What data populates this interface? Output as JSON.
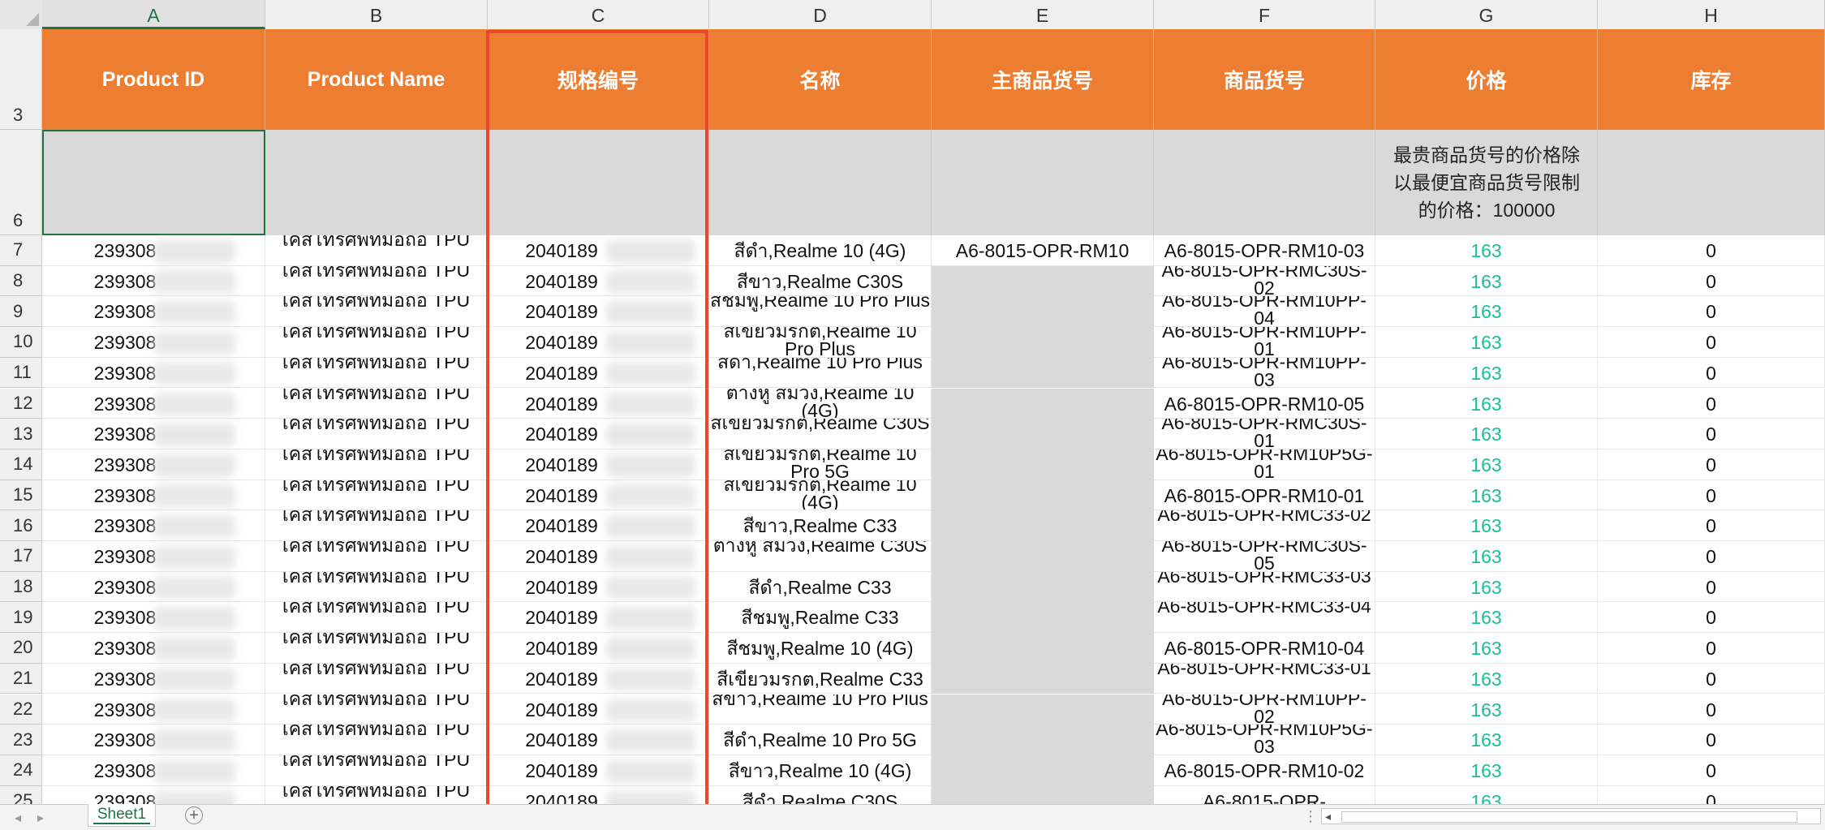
{
  "columns": [
    "A",
    "B",
    "C",
    "D",
    "E",
    "F",
    "G",
    "H"
  ],
  "header": {
    "row_number": "3",
    "labels": [
      "Product ID",
      "Product Name",
      "规格编号",
      "名称",
      "主商品货号",
      "商品货号",
      "价格",
      "库存"
    ]
  },
  "row6": {
    "row_number": "6",
    "note": "最贵商品货号的价格除以最便宜商品货号限制的价格：100000"
  },
  "rows": [
    {
      "n": "7",
      "id": "239308",
      "name": "เคสโทรศัพท์มือถือ TPU",
      "spec": "2040189",
      "title": "สีดำ,Realme 10 (4G)",
      "main_sku": "A6-8015-OPR-RM10",
      "sku": "A6-8015-OPR-RM10-03",
      "price": "163",
      "stock": "0"
    },
    {
      "n": "8",
      "id": "239308",
      "name": "เคสโทรศัพท์มือถือ TPU",
      "spec": "2040189",
      "title": "สีขาว,Realme C30S",
      "main_sku": "",
      "sku": "A6-8015-OPR-RMC30S-02",
      "price": "163",
      "stock": "0"
    },
    {
      "n": "9",
      "id": "239308",
      "name": "เคสโทรศัพท์มือถือ TPU",
      "spec": "2040189",
      "title": "สีชมพู,Realme 10 Pro Plus",
      "main_sku": "",
      "sku": "A6-8015-OPR-RM10PP-04",
      "price": "163",
      "stock": "0"
    },
    {
      "n": "10",
      "id": "239308",
      "name": "เคสโทรศัพท์มือถือ TPU",
      "spec": "2040189",
      "title": "สีเขียวมรกต,Realme 10 Pro Plus",
      "main_sku": "",
      "sku": "A6-8015-OPR-RM10PP-01",
      "price": "163",
      "stock": "0"
    },
    {
      "n": "11",
      "id": "239308",
      "name": "เคสโทรศัพท์มือถือ TPU",
      "spec": "2040189",
      "title": "สีดำ,Realme 10 Pro Plus",
      "main_sku": "",
      "sku": "A6-8015-OPR-RM10PP-03",
      "price": "163",
      "stock": "0"
    },
    {
      "n": "12",
      "id": "239308",
      "name": "เคสโทรศัพท์มือถือ TPU",
      "spec": "2040189",
      "title": "ต่างหู สีม่วง,Realme 10 (4G)",
      "main_sku": "",
      "sku": "A6-8015-OPR-RM10-05",
      "price": "163",
      "stock": "0"
    },
    {
      "n": "13",
      "id": "239308",
      "name": "เคสโทรศัพท์มือถือ TPU",
      "spec": "2040189",
      "title": "สีเขียวมรกต,Realme C30S",
      "main_sku": "",
      "sku": "A6-8015-OPR-RMC30S-01",
      "price": "163",
      "stock": "0"
    },
    {
      "n": "14",
      "id": "239308",
      "name": "เคสโทรศัพท์มือถือ TPU",
      "spec": "2040189",
      "title": "สีเขียวมรกต,Realme 10 Pro 5G",
      "main_sku": "",
      "sku": "A6-8015-OPR-RM10P5G-01",
      "price": "163",
      "stock": "0"
    },
    {
      "n": "15",
      "id": "239308",
      "name": "เคสโทรศัพท์มือถือ TPU",
      "spec": "2040189",
      "title": "สีเขียวมรกต,Realme 10 (4G)",
      "main_sku": "",
      "sku": "A6-8015-OPR-RM10-01",
      "price": "163",
      "stock": "0"
    },
    {
      "n": "16",
      "id": "239308",
      "name": "เคสโทรศัพท์มือถือ TPU",
      "spec": "2040189",
      "title": "สีขาว,Realme C33",
      "main_sku": "",
      "sku": "A6-8015-OPR-RMC33-02",
      "price": "163",
      "stock": "0"
    },
    {
      "n": "17",
      "id": "239308",
      "name": "เคสโทรศัพท์มือถือ TPU",
      "spec": "2040189",
      "title": "ต่างหู สีม่วง,Realme C30S",
      "main_sku": "",
      "sku": "A6-8015-OPR-RMC30S-05",
      "price": "163",
      "stock": "0"
    },
    {
      "n": "18",
      "id": "239308",
      "name": "เคสโทรศัพท์มือถือ TPU",
      "spec": "2040189",
      "title": "สีดำ,Realme C33",
      "main_sku": "",
      "sku": "A6-8015-OPR-RMC33-03",
      "price": "163",
      "stock": "0"
    },
    {
      "n": "19",
      "id": "239308",
      "name": "เคสโทรศัพท์มือถือ TPU",
      "spec": "2040189",
      "title": "สีชมพู,Realme C33",
      "main_sku": "",
      "sku": "A6-8015-OPR-RMC33-04",
      "price": "163",
      "stock": "0"
    },
    {
      "n": "20",
      "id": "239308",
      "name": "เคสโทรศัพท์มือถือ TPU",
      "spec": "2040189",
      "title": "สีชมพู,Realme 10 (4G)",
      "main_sku": "",
      "sku": "A6-8015-OPR-RM10-04",
      "price": "163",
      "stock": "0"
    },
    {
      "n": "21",
      "id": "239308",
      "name": "เคสโทรศัพท์มือถือ TPU",
      "spec": "2040189",
      "title": "สีเขียวมรกต,Realme C33",
      "main_sku": "",
      "sku": "A6-8015-OPR-RMC33-01",
      "price": "163",
      "stock": "0"
    },
    {
      "n": "22",
      "id": "239308",
      "name": "เคสโทรศัพท์มือถือ TPU",
      "spec": "2040189",
      "title": "สีขาว,Realme 10 Pro Plus",
      "main_sku": "",
      "sku": "A6-8015-OPR-RM10PP-02",
      "price": "163",
      "stock": "0"
    },
    {
      "n": "23",
      "id": "239308",
      "name": "เคสโทรศัพท์มือถือ TPU",
      "spec": "2040189",
      "title": "สีดำ,Realme 10 Pro 5G",
      "main_sku": "",
      "sku": "A6-8015-OPR-RM10P5G-03",
      "price": "163",
      "stock": "0"
    },
    {
      "n": "24",
      "id": "239308",
      "name": "เคสโทรศัพท์มือถือ TPU",
      "spec": "2040189",
      "title": "สีขาว,Realme 10 (4G)",
      "main_sku": "",
      "sku": "A6-8015-OPR-RM10-02",
      "price": "163",
      "stock": "0"
    },
    {
      "n": "25",
      "id": "239308",
      "name": "เคสโทรศัพท์มือถือ TPU",
      "spec": "2040189",
      "title": "สีดำ,Realme C30S",
      "main_sku": "",
      "sku": "A6-8015-OPR-",
      "price": "163",
      "stock": "0"
    }
  ],
  "sheet_tab": "Sheet1",
  "add_sheet": "+",
  "colors": {
    "header_orange": "#ed7d31",
    "price_teal": "#1abc9c",
    "highlight_red": "#e8482b",
    "excel_green": "#217346"
  }
}
